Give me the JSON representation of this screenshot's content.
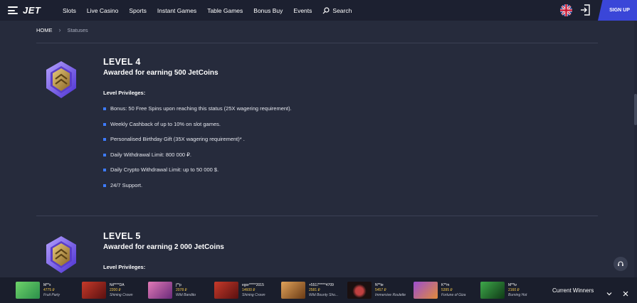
{
  "header": {
    "logo": "JET",
    "nav": [
      "Slots",
      "Live Casino",
      "Sports",
      "Instant Games",
      "Table Games",
      "Bonus Buy",
      "Events"
    ],
    "search_label": "Search",
    "signup_label": "SIGN UP"
  },
  "breadcrumb": {
    "home": "HOME",
    "separator": "›",
    "current": "Statuses"
  },
  "levels": [
    {
      "title": "LEVEL 4",
      "subtitle": "Awarded for earning 500 JetCoins",
      "privileges_label": "Level Privileges:",
      "privileges": [
        "Bonus: 50 Free Spins upon reaching this status (25X wagering requirement).",
        "Weekly Cashback of up to 10% on slot games.",
        "Personalised Birthday Gift (35X wagering requirement)* .",
        "Daily Withdrawal Limit: 800 000 ₽.",
        "Daily Crypto Withdrawal Limit: up to 50 000 $.",
        "24/7 Support."
      ]
    },
    {
      "title": "LEVEL 5",
      "subtitle": "Awarded for earning 2 000 JetCoins",
      "privileges_label": "Level Privileges:"
    }
  ],
  "winners_bar": {
    "label": "Current Winners",
    "items": [
      {
        "user": "M**x",
        "amount": "4775 ₽",
        "game": "Fruit Party",
        "color": "#3aa35a"
      },
      {
        "user": "Nil****DA",
        "amount": "2200 ₽",
        "game": "Shining Crown",
        "color": "#8c1f1f"
      },
      {
        "user": "j**p",
        "amount": "2078 ₽",
        "game": "Wild Bandito",
        "color": "#b44a8c"
      },
      {
        "user": "egor*****2015",
        "amount": "14600 ₽",
        "game": "Shining Crown",
        "color": "#8c1f1f"
      },
      {
        "user": "+5517*****4709",
        "amount": "2581 ₽",
        "game": "Wild Bounty Sho...",
        "color": "#a0642a"
      },
      {
        "user": "N**te",
        "amount": "5457 ₽",
        "game": "Immersive Roulette",
        "color": "#2a1a1a"
      },
      {
        "user": "K**m",
        "amount": "5395 ₽",
        "game": "Fortune of Giza",
        "color": "#7a3aa0"
      },
      {
        "user": "M**tv",
        "amount": "2160 ₽",
        "game": "Burning Hot",
        "color": "#1f6b2a"
      }
    ]
  },
  "colors": {
    "accent": "#3a46d8",
    "bullet": "#3d7bff",
    "amount": "#f7c948"
  }
}
